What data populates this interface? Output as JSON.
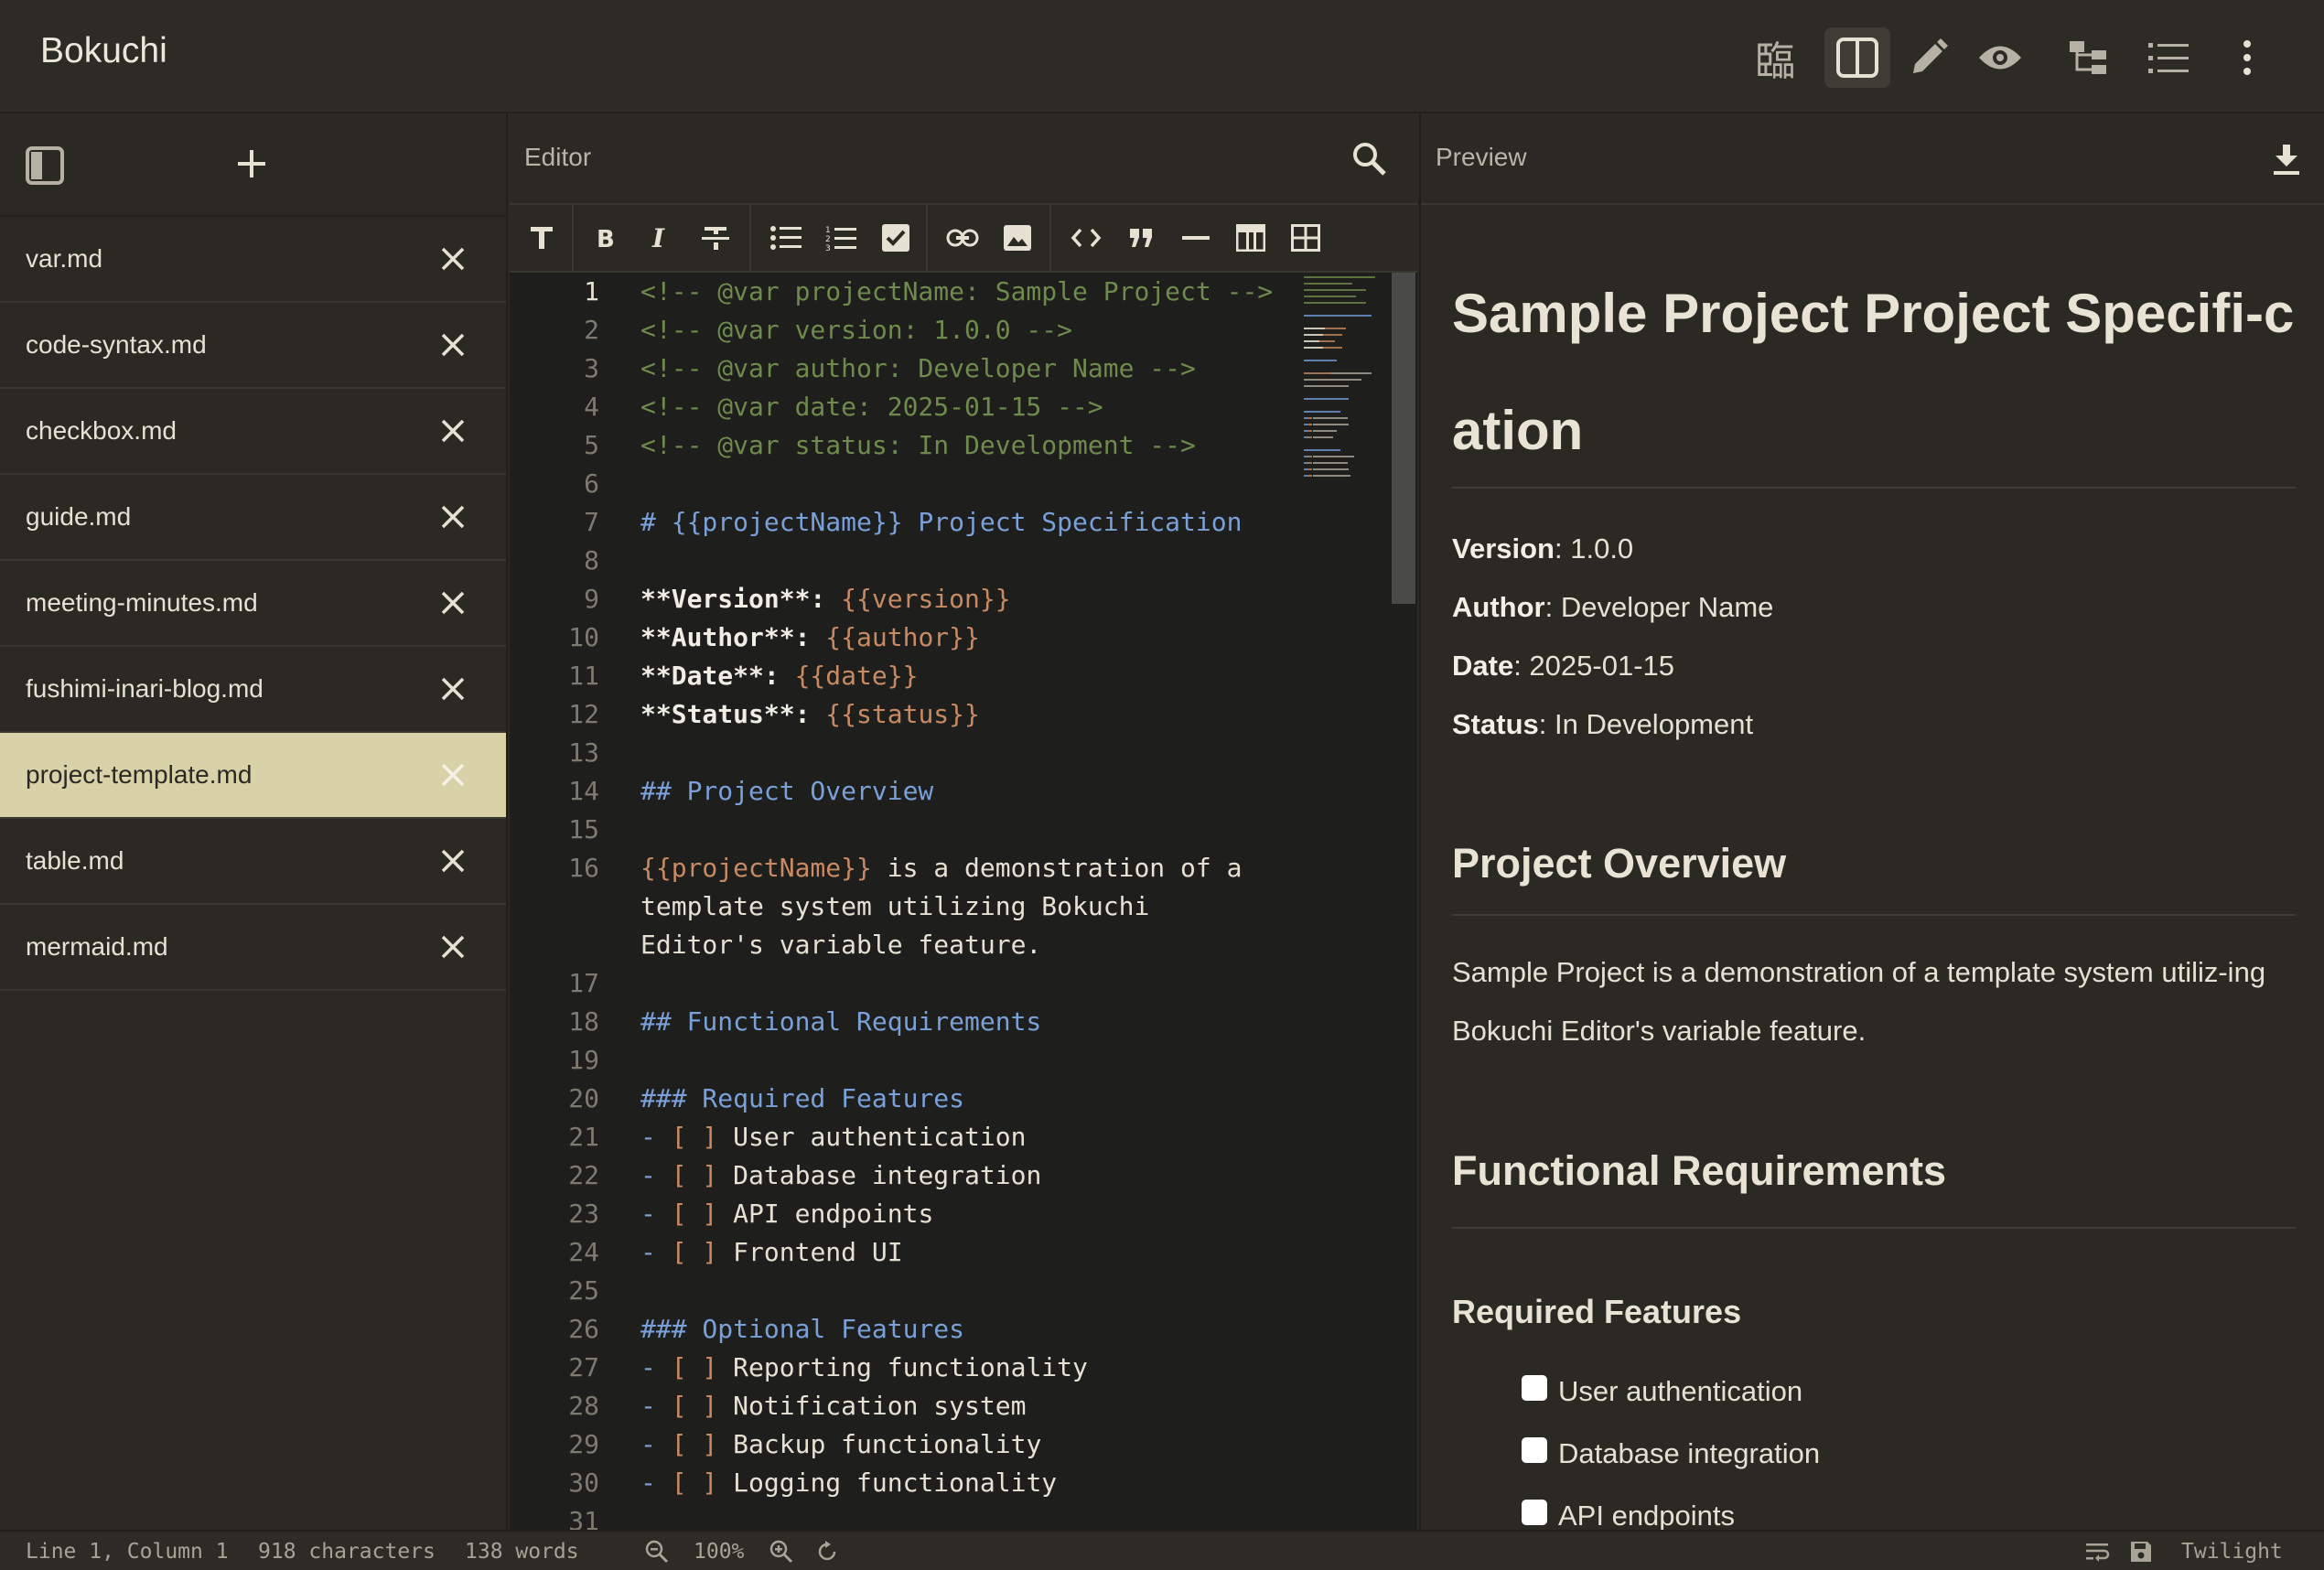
{
  "app": {
    "title": "Bokuchi",
    "kanji": "臨"
  },
  "sidebar": {
    "files": [
      {
        "name": "var.md",
        "active": false
      },
      {
        "name": "code-syntax.md",
        "active": false
      },
      {
        "name": "checkbox.md",
        "active": false
      },
      {
        "name": "guide.md",
        "active": false
      },
      {
        "name": "meeting-minutes.md",
        "active": false
      },
      {
        "name": "fushimi-inari-blog.md",
        "active": false
      },
      {
        "name": "project-template.md",
        "active": true
      },
      {
        "name": "table.md",
        "active": false
      },
      {
        "name": "mermaid.md",
        "active": false
      }
    ]
  },
  "editor": {
    "title": "Editor",
    "line_numbers": [
      "1",
      "2",
      "3",
      "4",
      "5",
      "6",
      "7",
      "8",
      "9",
      "10",
      "11",
      "12",
      "13",
      "14",
      "15",
      "16",
      "",
      "",
      "17",
      "18",
      "19",
      "20",
      "21",
      "22",
      "23",
      "24",
      "25",
      "26",
      "27",
      "28",
      "29",
      "30",
      "31"
    ],
    "lines": [
      [
        {
          "t": "<!-- @var projectName: Sample Project -->",
          "c": "c-comment"
        }
      ],
      [
        {
          "t": "<!-- @var version: 1.0.0 -->",
          "c": "c-comment"
        }
      ],
      [
        {
          "t": "<!-- @var author: Developer Name -->",
          "c": "c-comment"
        }
      ],
      [
        {
          "t": "<!-- @var date: 2025-01-15 -->",
          "c": "c-comment"
        }
      ],
      [
        {
          "t": "<!-- @var status: In Development -->",
          "c": "c-comment"
        }
      ],
      [],
      [
        {
          "t": "# {{projectName}} Project Specification",
          "c": "c-head"
        }
      ],
      [],
      [
        {
          "t": "**Version**:",
          "c": "c-bold"
        },
        {
          "t": " {{version}}",
          "c": "c-var"
        }
      ],
      [
        {
          "t": "**Author**:",
          "c": "c-bold"
        },
        {
          "t": " {{author}}",
          "c": "c-var"
        }
      ],
      [
        {
          "t": "**Date**:",
          "c": "c-bold"
        },
        {
          "t": " {{date}}",
          "c": "c-var"
        }
      ],
      [
        {
          "t": "**Status**:",
          "c": "c-bold"
        },
        {
          "t": " {{status}}",
          "c": "c-var"
        }
      ],
      [],
      [
        {
          "t": "## Project Overview",
          "c": "c-head"
        }
      ],
      [],
      [
        {
          "t": "{{projectName}}",
          "c": "c-var"
        },
        {
          "t": " is a demonstration of a",
          "c": ""
        }
      ],
      [
        {
          "t": "template system utilizing Bokuchi",
          "c": ""
        }
      ],
      [
        {
          "t": "Editor's variable feature.",
          "c": ""
        }
      ],
      [],
      [
        {
          "t": "## Functional Requirements",
          "c": "c-head"
        }
      ],
      [],
      [
        {
          "t": "### Required Features",
          "c": "c-head"
        }
      ],
      [
        {
          "t": "- ",
          "c": "c-dash"
        },
        {
          "t": "[ ]",
          "c": "c-check"
        },
        {
          "t": " User authentication",
          "c": ""
        }
      ],
      [
        {
          "t": "- ",
          "c": "c-dash"
        },
        {
          "t": "[ ]",
          "c": "c-check"
        },
        {
          "t": " Database integration",
          "c": ""
        }
      ],
      [
        {
          "t": "- ",
          "c": "c-dash"
        },
        {
          "t": "[ ]",
          "c": "c-check"
        },
        {
          "t": " API endpoints",
          "c": ""
        }
      ],
      [
        {
          "t": "- ",
          "c": "c-dash"
        },
        {
          "t": "[ ]",
          "c": "c-check"
        },
        {
          "t": " Frontend UI",
          "c": ""
        }
      ],
      [],
      [
        {
          "t": "### Optional Features",
          "c": "c-head"
        }
      ],
      [
        {
          "t": "- ",
          "c": "c-dash"
        },
        {
          "t": "[ ]",
          "c": "c-check"
        },
        {
          "t": " Reporting functionality",
          "c": ""
        }
      ],
      [
        {
          "t": "- ",
          "c": "c-dash"
        },
        {
          "t": "[ ]",
          "c": "c-check"
        },
        {
          "t": " Notification system",
          "c": ""
        }
      ],
      [
        {
          "t": "- ",
          "c": "c-dash"
        },
        {
          "t": "[ ]",
          "c": "c-check"
        },
        {
          "t": " Backup functionality",
          "c": ""
        }
      ],
      [
        {
          "t": "- ",
          "c": "c-dash"
        },
        {
          "t": "[ ]",
          "c": "c-check"
        },
        {
          "t": " Logging functionality",
          "c": ""
        }
      ],
      []
    ]
  },
  "preview": {
    "title": "Preview",
    "h1": "Sample Project Project Specifi-cation",
    "meta": [
      {
        "label": "Version",
        "value": ": 1.0.0"
      },
      {
        "label": "Author",
        "value": ": Developer Name"
      },
      {
        "label": "Date",
        "value": ": 2025-01-15"
      },
      {
        "label": "Status",
        "value": ": In Development"
      }
    ],
    "overview_heading": "Project Overview",
    "overview_text": "Sample Project is a demonstration of a template system utiliz-ing Bokuchi Editor's variable feature.",
    "functional_heading": "Functional Requirements",
    "required_heading": "Required Features",
    "tasks": [
      "User authentication",
      "Database integration",
      "API endpoints"
    ]
  },
  "statusbar": {
    "position": "Line 1, Column 1",
    "characters": "918 characters",
    "words": "138 words",
    "zoom": "100%",
    "theme": "Twilight"
  }
}
